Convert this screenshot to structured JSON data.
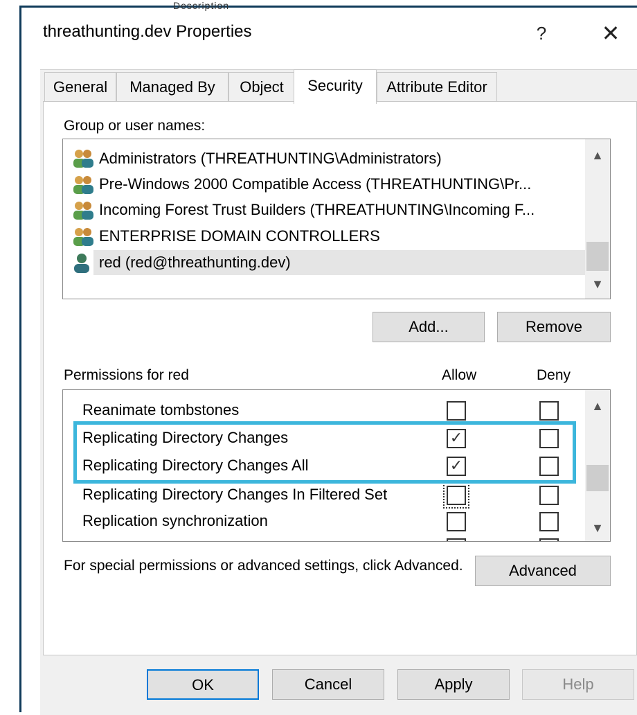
{
  "window": {
    "title": "threathunting.dev Properties",
    "help_glyph": "?",
    "close_glyph": "✕",
    "behind_text": "Description"
  },
  "tabs": [
    {
      "label": "General"
    },
    {
      "label": "Managed By"
    },
    {
      "label": "Object"
    },
    {
      "label": "Security",
      "active": true
    },
    {
      "label": "Attribute Editor"
    }
  ],
  "security": {
    "group_label": "Group or user names:",
    "principals": [
      {
        "name": "Administrators (THREATHUNTING\\Administrators)",
        "icon": "group-icon"
      },
      {
        "name": "Pre-Windows 2000 Compatible Access (THREATHUNTING\\Pr...",
        "icon": "group-icon"
      },
      {
        "name": "Incoming Forest Trust Builders (THREATHUNTING\\Incoming F...",
        "icon": "group-icon"
      },
      {
        "name": "ENTERPRISE DOMAIN CONTROLLERS",
        "icon": "group-icon"
      },
      {
        "name": "red (red@threathunting.dev)",
        "icon": "user-icon",
        "selected": true
      }
    ],
    "add_label": "Add...",
    "remove_label": "Remove",
    "permissions_label": "Permissions for red",
    "allow_header": "Allow",
    "deny_header": "Deny",
    "permissions": [
      {
        "name": "Reanimate tombstones",
        "allow": false,
        "deny": false
      },
      {
        "name": "Replicating Directory Changes",
        "allow": true,
        "deny": false
      },
      {
        "name": "Replicating Directory Changes All",
        "allow": true,
        "deny": false
      },
      {
        "name": "Replicating Directory Changes In Filtered Set",
        "allow": false,
        "deny": false
      },
      {
        "name": "Replication synchronization",
        "allow": false,
        "deny": false
      }
    ],
    "advanced_text": "For special permissions or advanced settings, click Advanced.",
    "advanced_label": "Advanced"
  },
  "buttons": {
    "ok": "OK",
    "cancel": "Cancel",
    "apply": "Apply",
    "help": "Help"
  },
  "colors": {
    "highlight": "#3cb6dc",
    "focus": "#0078d7",
    "frame": "#0f3a5a"
  }
}
